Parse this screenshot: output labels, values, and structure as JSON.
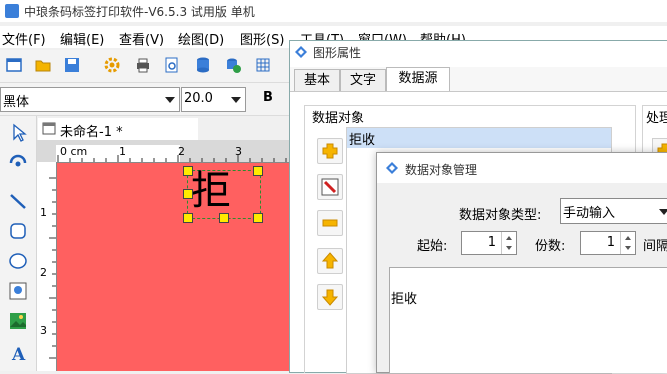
{
  "app": {
    "title": "中琅条码标签打印软件-V6.5.3 试用版 单机"
  },
  "menu": {
    "items": [
      "文件(F)",
      "编辑(E)",
      "查看(V)",
      "绘图(D)",
      "图形(S)",
      "工具(T)",
      "窗口(W)",
      "帮助(H)"
    ]
  },
  "font_toolbar": {
    "font_name": "黑体",
    "font_size": "20.0",
    "bold_label": "B"
  },
  "document": {
    "tab_label": "未命名-1 *",
    "canvas_text": "拒",
    "canvas_color": "#ff6060"
  },
  "ruler": {
    "unit_label": "0 cm",
    "h_ticks": [
      "1",
      "2",
      "3"
    ],
    "v_ticks": [
      "1",
      "2",
      "3"
    ]
  },
  "prop_dialog": {
    "title": "图形属性",
    "tabs": [
      "基本",
      "文字",
      "数据源"
    ],
    "active_tab": "数据源",
    "data_object_group_label": "数据对象",
    "processing_group_label": "处理",
    "data_objects": [
      "拒收"
    ]
  },
  "mgr_dialog": {
    "title": "数据对象管理",
    "type_label": "数据对象类型:",
    "type_value": "手动输入",
    "start_label": "起始:",
    "start_value": "1",
    "copies_label": "份数:",
    "copies_value": "1",
    "interval_label": "间隔",
    "content": "拒收"
  },
  "colors": {
    "accent": "#3b7fd9",
    "selection": "#cde0f7",
    "canvas": "#ff6060"
  }
}
